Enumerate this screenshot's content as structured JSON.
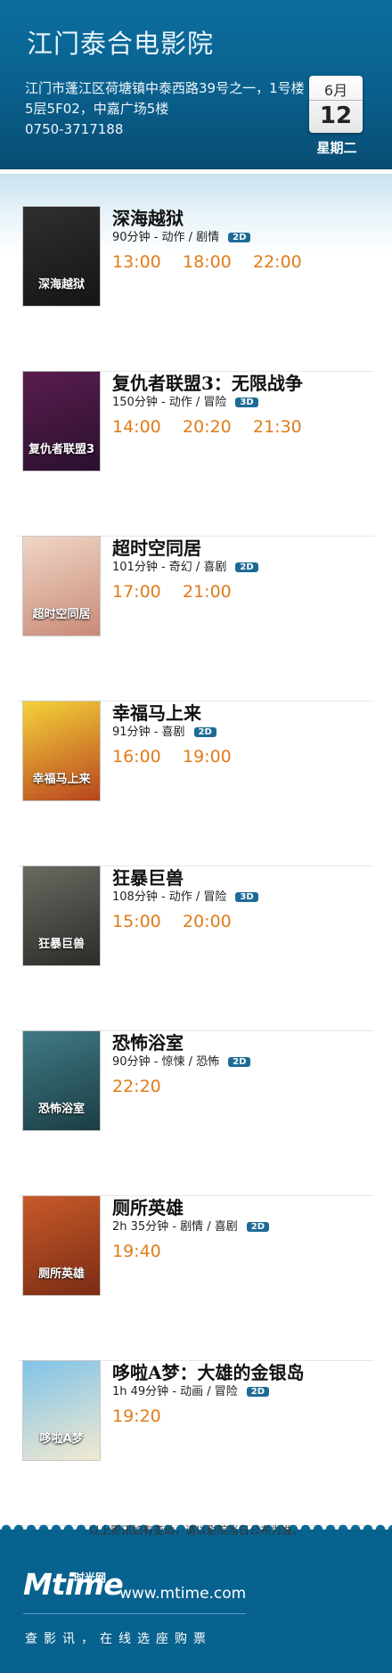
{
  "cinema": {
    "name": "江门泰合电影院",
    "address": "江门市蓬江区荷塘镇中泰西路39号之一，1号楼5层5F02，中嘉广场5楼",
    "phone": "0750-3717188"
  },
  "date": {
    "month": "6月",
    "day": "12",
    "weekday": "星期二"
  },
  "movies": [
    {
      "title": "深海越狱",
      "info": "90分钟 - 动作 / 剧情",
      "format": "2D",
      "times": [
        "13:00",
        "18:00",
        "22:00"
      ],
      "poster_text": "深海越狱",
      "poster_colors": [
        "#2f2f2f",
        "#151515"
      ]
    },
    {
      "title": "复仇者联盟3：无限战争",
      "info": "150分钟 - 动作 / 冒险",
      "format": "3D",
      "times": [
        "14:00",
        "20:20",
        "21:30"
      ],
      "poster_text": "复仇者联盟3",
      "poster_colors": [
        "#5a1d4e",
        "#2a1030"
      ]
    },
    {
      "title": "超时空同居",
      "info": "101分钟 - 奇幻 / 喜剧",
      "format": "2D",
      "times": [
        "17:00",
        "21:00"
      ],
      "poster_text": "超时空同居",
      "poster_colors": [
        "#f0d6c6",
        "#c98a78"
      ]
    },
    {
      "title": "幸福马上来",
      "info": "91分钟 - 喜剧",
      "format": "2D",
      "times": [
        "16:00",
        "19:00"
      ],
      "poster_text": "幸福马上来",
      "poster_colors": [
        "#f5d23a",
        "#b8451f"
      ]
    },
    {
      "title": "狂暴巨兽",
      "info": "108分钟 - 动作 / 冒险",
      "format": "3D",
      "times": [
        "15:00",
        "20:00"
      ],
      "poster_text": "狂暴巨兽",
      "poster_colors": [
        "#6a6a62",
        "#2c2b28"
      ]
    },
    {
      "title": "恐怖浴室",
      "info": "90分钟 - 惊悚 / 恐怖",
      "format": "2D",
      "times": [
        "22:20"
      ],
      "poster_text": "恐怖浴室",
      "poster_colors": [
        "#3f7a86",
        "#1c3d44"
      ]
    },
    {
      "title": "厕所英雄",
      "info": "2h 35分钟 - 剧情 / 喜剧",
      "format": "2D",
      "times": [
        "19:40"
      ],
      "poster_text": "厕所英雄",
      "poster_colors": [
        "#c85a2a",
        "#7a2c14"
      ]
    },
    {
      "title": "哆啦A梦：大雄的金银岛",
      "info": "1h 49分钟 - 动画 / 冒险",
      "format": "2D",
      "times": [
        "19:20"
      ],
      "poster_text": "哆啦A梦",
      "poster_colors": [
        "#7fc3e8",
        "#f2e9d0"
      ]
    }
  ],
  "notice": "以上影讯如有变动，请以影院当日公布为准。",
  "footer": {
    "logo": "Mtime",
    "logo_cn": "时光网",
    "site": "www.mtime.com",
    "slogan": "查影讯，在线选座购票"
  }
}
